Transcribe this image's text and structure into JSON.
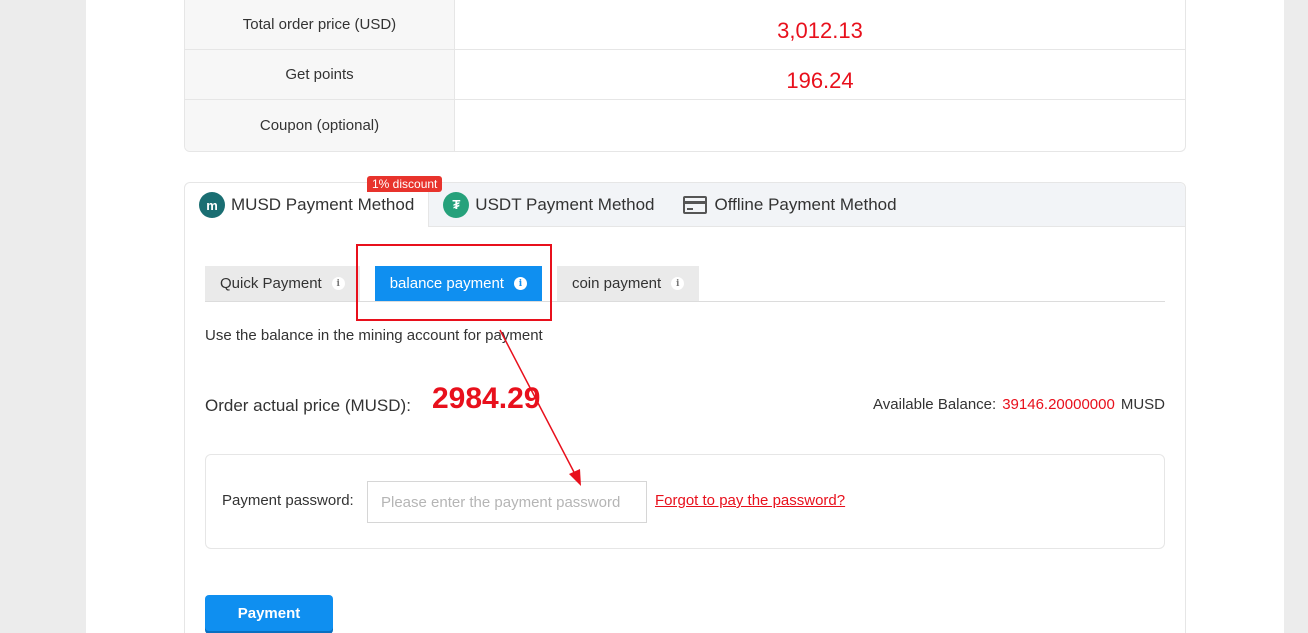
{
  "summary": {
    "rows": [
      {
        "label": "Total order price (USD)",
        "value": "3,012.13"
      },
      {
        "label": "Get points",
        "value": "196.24"
      },
      {
        "label": "Coupon (optional)",
        "value": ""
      }
    ]
  },
  "method_tabs": [
    {
      "label": "MUSD Payment Method",
      "icon": "musd-coin-icon",
      "badge": "1% discount",
      "active": true
    },
    {
      "label": "USDT Payment Method",
      "icon": "usdt-coin-icon"
    },
    {
      "label": "Offline Payment Method",
      "icon": "credit-card-icon"
    }
  ],
  "sub_tabs": [
    {
      "label": "Quick Payment",
      "active": false
    },
    {
      "label": "balance payment",
      "active": true
    },
    {
      "label": "coin payment",
      "active": false
    }
  ],
  "description": "Use the balance in the mining account for payment",
  "order": {
    "price_label": "Order actual price (MUSD):",
    "price_value": "2984.29",
    "balance_label": "Available Balance:",
    "balance_value": "39146.20000000",
    "balance_unit": "MUSD"
  },
  "password": {
    "label": "Payment password:",
    "placeholder": "Please enter the payment password",
    "forgot_link": "Forgot to pay the password?"
  },
  "pay_button": "Payment",
  "colors": {
    "accent": "#0f8ff0",
    "price_red": "#e8101c",
    "annotation": "#e8101c"
  }
}
